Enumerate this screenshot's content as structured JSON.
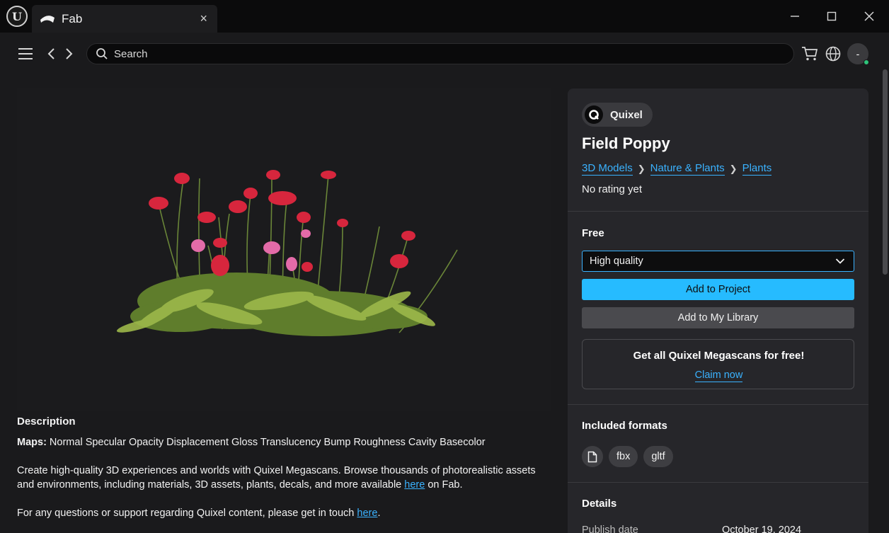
{
  "window": {
    "tab_title": "Fab",
    "tab_close": "×"
  },
  "nav": {
    "search_placeholder": "Search",
    "avatar_label": "-"
  },
  "product": {
    "publisher": "Quixel",
    "title": "Field Poppy",
    "breadcrumbs": [
      "3D Models",
      "Nature & Plants",
      "Plants"
    ],
    "rating": "No rating yet",
    "price": "Free",
    "quality_selected": "High quality",
    "add_to_project": "Add to Project",
    "add_to_library": "Add to My Library",
    "promo_title": "Get all Quixel Megascans for free!",
    "promo_link": "Claim now",
    "formats_title": "Included formats",
    "formats": [
      "fbx",
      "gltf"
    ],
    "details_title": "Details",
    "details": [
      {
        "label": "Publish date",
        "value": "October 19, 2024"
      }
    ]
  },
  "description": {
    "heading": "Description",
    "maps_label": "Maps:",
    "maps_value": " Normal Specular Opacity Displacement Gloss Translucency Bump Roughness Cavity Basecolor",
    "para1_text": "Create high-quality 3D experiences and worlds with Quixel Megascans. Browse thousands of photorealistic assets and environments, including materials, 3D assets, plants, decals, and more available ",
    "para1_link": "here",
    "para1_tail": " on Fab.",
    "para2_text": "For any questions or support regarding Quixel content, please get in touch ",
    "para2_link": "here",
    "para2_tail": "."
  },
  "colors": {
    "accent": "#26bbff",
    "link": "#3ab2ff",
    "panel": "#26262a",
    "background": "#1a1a1c"
  }
}
